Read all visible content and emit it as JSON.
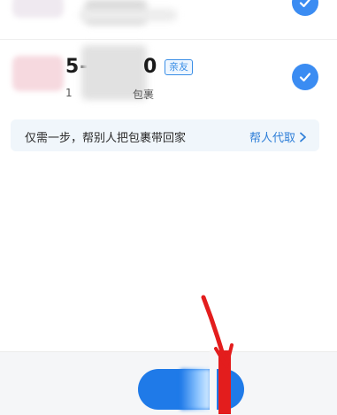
{
  "list": {
    "item2": {
      "phone_prefix": "5-",
      "phone_suffix": "0",
      "tag": "亲友",
      "sub_prefix": "1",
      "sub_suffix": "包裹"
    }
  },
  "banner": {
    "text": "仅需一步，帮别人把包裹带回家",
    "link_label": "帮人代取",
    "link_icon": "chevron-right-icon"
  },
  "colors": {
    "accent": "#3b8cf2",
    "annotation": "#e31d1d"
  }
}
